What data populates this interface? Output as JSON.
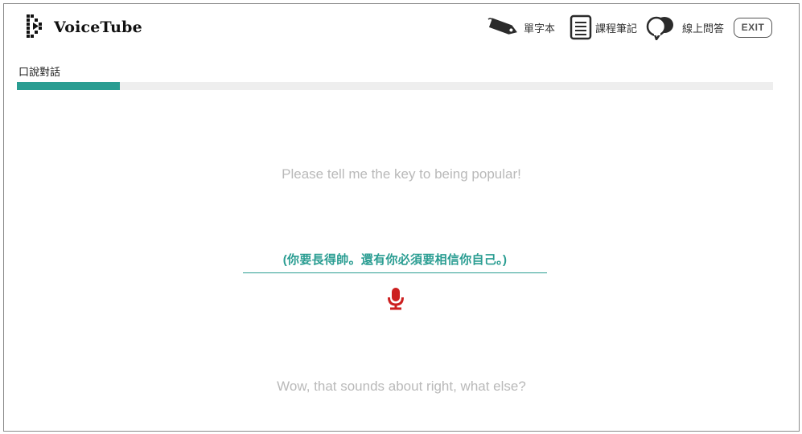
{
  "brand": {
    "name": "VoiceTube"
  },
  "nav": {
    "vocab_label": "單字本",
    "notes_label": "課程筆記",
    "qa_label": "線上問答",
    "exit_label": "EXIT"
  },
  "lesson": {
    "section_title": "口說對話",
    "progress_fraction": 0.136,
    "prompt": "Please tell me the key to being popular!",
    "answer_hint": "(你要長得帥。還有你必須要相信你自己。)",
    "reply": "Wow, that sounds about right, what else?"
  },
  "colors": {
    "accent": "#2a9d92",
    "mic": "#cc1f1f",
    "muted_text": "#b9b9b9",
    "progress_track": "#eeeeee"
  },
  "icons": {
    "logo": "voicetube-logo-icon",
    "vocab": "price-tag-icon",
    "notes": "notepad-icon",
    "qa": "speech-bubbles-icon",
    "mic": "microphone-icon"
  }
}
